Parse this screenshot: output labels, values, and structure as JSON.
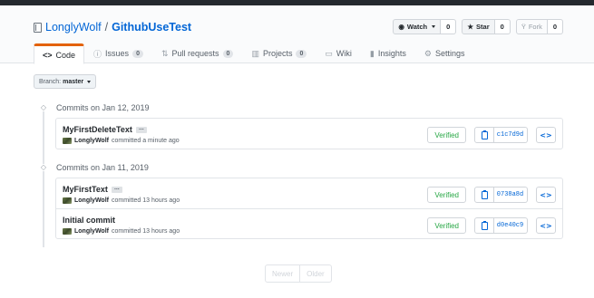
{
  "repo": {
    "owner": "LonglyWolf",
    "separator": "/",
    "name": "GithubUseTest"
  },
  "actions": {
    "watch": {
      "label": "Watch",
      "icon": "eye-icon",
      "count": "0"
    },
    "star": {
      "label": "Star",
      "icon": "star-icon",
      "count": "0"
    },
    "fork": {
      "label": "Fork",
      "icon": "fork-icon",
      "count": "0"
    }
  },
  "tabs": [
    {
      "label": "Code",
      "icon": "code-icon",
      "selected": true
    },
    {
      "label": "Issues",
      "icon": "issue-icon",
      "count": "0"
    },
    {
      "label": "Pull requests",
      "icon": "pull-request-icon",
      "count": "0"
    },
    {
      "label": "Projects",
      "icon": "project-icon",
      "count": "0"
    },
    {
      "label": "Wiki",
      "icon": "book-icon"
    },
    {
      "label": "Insights",
      "icon": "graph-icon"
    },
    {
      "label": "Settings",
      "icon": "gear-icon"
    }
  ],
  "branch": {
    "label": "Branch:",
    "name": "master"
  },
  "groups": [
    {
      "title": "Commits on Jan 12, 2019",
      "commits": [
        {
          "message": "MyFirstDeleteText",
          "ellipsis": "…",
          "author": "LonglyWolf",
          "time": "committed a minute ago",
          "verified": "Verified",
          "sha": "c1c7d9d"
        }
      ]
    },
    {
      "title": "Commits on Jan 11, 2019",
      "commits": [
        {
          "message": "MyFirstText",
          "ellipsis": "…",
          "author": "LonglyWolf",
          "time": "committed 13 hours ago",
          "verified": "Verified",
          "sha": "0738a8d"
        },
        {
          "message": "Initial commit",
          "author": "LonglyWolf",
          "time": "committed 13 hours ago",
          "verified": "Verified",
          "sha": "d0e40c9"
        }
      ]
    }
  ],
  "pagination": {
    "newer": "Newer",
    "older": "Older"
  },
  "colors": {
    "accent": "#0366d6",
    "verified": "#28a745",
    "tab_underline": "#e36209"
  }
}
